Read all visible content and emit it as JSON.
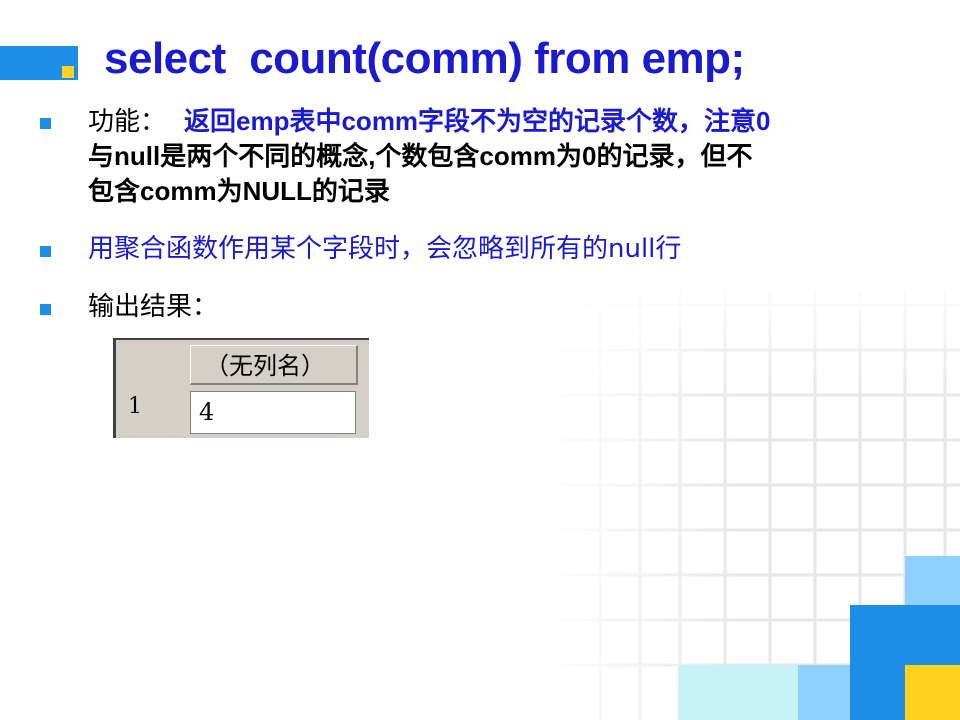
{
  "slide": {
    "title": "select  count(comm) from emp;",
    "colors": {
      "accent_blue": "#1e8de6",
      "text_blue": "#1a1ad0",
      "accent_yellow": "#ffd21f"
    },
    "bullets": [
      {
        "prefix": "功能：",
        "lines": [
          "返回emp表中comm字段不为空的记录个数，注意0",
          "与null是两个不同的概念,个数包含comm为0的记录，但不",
          "包含comm为NULL的记录"
        ]
      },
      {
        "text": "用聚合函数作用某个字段时，会忽略到所有的null行"
      },
      {
        "text": "输出结果："
      }
    ],
    "result_table": {
      "column_header": "（无列名）",
      "rows": [
        {
          "row_number": "1",
          "value": "4"
        }
      ]
    }
  }
}
